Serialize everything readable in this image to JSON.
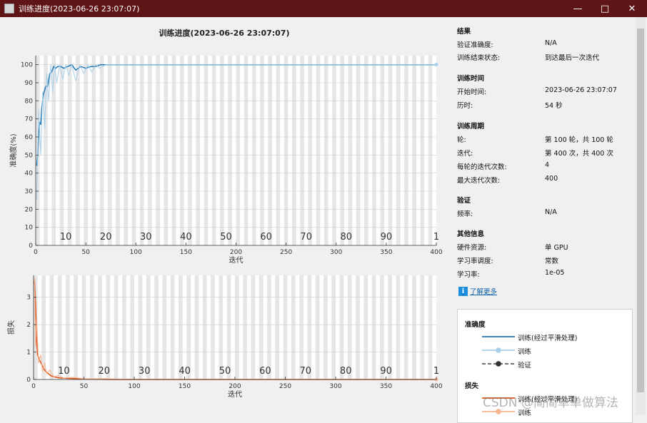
{
  "window": {
    "title": "训练进度(2023-06-26 23:07:07)",
    "minimize_icon": "minimize-icon",
    "maximize_icon": "maximize-icon",
    "close_icon": "close-icon"
  },
  "plot_title": "训练进度(2023-06-26 23:07:07)",
  "chart_data": [
    {
      "type": "line",
      "xlabel": "迭代",
      "ylabel": "准确度(%)",
      "xlim": [
        0,
        400
      ],
      "ylim": [
        0,
        105
      ],
      "xticks": [
        0,
        50,
        100,
        150,
        200,
        250,
        300,
        350,
        400
      ],
      "yticks": [
        0,
        10,
        20,
        30,
        40,
        50,
        60,
        70,
        80,
        90,
        100
      ],
      "epoch_labels": [
        "10",
        "20",
        "30",
        "40",
        "50",
        "60",
        "70",
        "80",
        "90",
        "1"
      ],
      "epoch_label_iterations": [
        40,
        80,
        120,
        160,
        200,
        240,
        280,
        320,
        360,
        400
      ],
      "series": [
        {
          "name": "训练(经过平滑处理)",
          "color": "#1f77b4",
          "x": [
            1,
            2,
            3,
            4,
            5,
            6,
            7,
            8,
            10,
            12,
            14,
            16,
            18,
            20,
            22,
            25,
            28,
            32,
            36,
            40,
            45,
            50,
            55,
            60,
            65,
            70,
            100,
            200,
            300,
            400
          ],
          "y": [
            44,
            50,
            62,
            68,
            67,
            76,
            80,
            84,
            88,
            88,
            95,
            96,
            99,
            98,
            99,
            99,
            98,
            99,
            100,
            97,
            99,
            98,
            99,
            99,
            100,
            100,
            100,
            100,
            100,
            100
          ]
        },
        {
          "name": "训练",
          "color": "#a9cfe9",
          "x": [
            1,
            3,
            5,
            7,
            9,
            11,
            13,
            15,
            17,
            19,
            21,
            24,
            27,
            30,
            33,
            36,
            40,
            44,
            48,
            52,
            56,
            60,
            64,
            70,
            100,
            400
          ],
          "y": [
            25,
            75,
            50,
            85,
            65,
            95,
            80,
            100,
            85,
            100,
            90,
            100,
            92,
            100,
            94,
            100,
            91,
            100,
            95,
            100,
            96,
            100,
            98,
            100,
            100,
            100
          ]
        }
      ]
    },
    {
      "type": "line",
      "xlabel": "迭代",
      "ylabel": "损失",
      "xlim": [
        0,
        400
      ],
      "ylim": [
        0,
        3.8
      ],
      "xticks": [
        0,
        50,
        100,
        150,
        200,
        250,
        300,
        350,
        400
      ],
      "yticks": [
        0,
        1,
        2,
        3
      ],
      "epoch_labels": [
        "10",
        "20",
        "30",
        "40",
        "50",
        "60",
        "70",
        "80",
        "90",
        "1"
      ],
      "epoch_label_iterations": [
        40,
        80,
        120,
        160,
        200,
        240,
        280,
        320,
        360,
        400
      ],
      "series": [
        {
          "name": "训练(经过平滑处理)",
          "color": "#d95319",
          "x": [
            1,
            2,
            3,
            4,
            6,
            8,
            10,
            12,
            15,
            18,
            22,
            26,
            30,
            40,
            50,
            60,
            80,
            100,
            200,
            300,
            400
          ],
          "y": [
            3.6,
            2.8,
            1.5,
            0.9,
            0.7,
            0.55,
            0.4,
            0.3,
            0.2,
            0.12,
            0.08,
            0.06,
            0.05,
            0.03,
            0.02,
            0.01,
            0.0,
            0.0,
            0.0,
            0.0,
            0.0
          ]
        },
        {
          "name": "训练",
          "color": "#f4b48f",
          "x": [
            1,
            2,
            3,
            5,
            7,
            9,
            11,
            13,
            16,
            20,
            25,
            30,
            40,
            50,
            70,
            100,
            400
          ],
          "y": [
            3.7,
            1.2,
            2.2,
            0.6,
            0.9,
            0.3,
            0.6,
            0.2,
            0.35,
            0.1,
            0.15,
            0.05,
            0.08,
            0.02,
            0.03,
            0.0,
            0.0
          ]
        }
      ]
    }
  ],
  "side": {
    "results": {
      "title": "结果",
      "rows": [
        {
          "label": "验证准确度:",
          "value": "N/A"
        },
        {
          "label": "训练结束状态:",
          "value": "到达最后一次迭代"
        }
      ]
    },
    "time": {
      "title": "训练时间",
      "rows": [
        {
          "label": "开始时间:",
          "value": "2023-06-26 23:07:07"
        },
        {
          "label": "历时:",
          "value": "54 秒"
        }
      ]
    },
    "cycle": {
      "title": "训练周期",
      "rows": [
        {
          "label": "轮:",
          "value": "第 100 轮，共 100 轮"
        },
        {
          "label": "迭代:",
          "value": "第 400 次，共 400 次"
        },
        {
          "label": "每轮的迭代次数:",
          "value": "4"
        },
        {
          "label": "最大迭代次数:",
          "value": "400"
        }
      ]
    },
    "validation": {
      "title": "验证",
      "rows": [
        {
          "label": "频率:",
          "value": "N/A"
        }
      ]
    },
    "other": {
      "title": "其他信息",
      "rows": [
        {
          "label": "硬件资源:",
          "value": "单 GPU"
        },
        {
          "label": "学习率调度:",
          "value": "常数"
        },
        {
          "label": "学习率:",
          "value": "1e-05"
        }
      ]
    },
    "learn_more": "了解更多",
    "learn_more_icon": "info-icon"
  },
  "legend": {
    "accuracy_title": "准确度",
    "accuracy_items": [
      {
        "label": "训练(经过平滑处理)",
        "color": "#1f77b4",
        "style": "solid"
      },
      {
        "label": "训练",
        "color": "#a9cfe9",
        "style": "solid-marker"
      },
      {
        "label": "验证",
        "color": "#444444",
        "style": "dashed-marker"
      }
    ],
    "loss_title": "损失",
    "loss_items": [
      {
        "label": "训练(经过平滑处理)",
        "color": "#d95319",
        "style": "solid"
      },
      {
        "label": "训练",
        "color": "#f4b48f",
        "style": "solid-marker"
      }
    ]
  },
  "watermark": "CSDN @简简单单做算法"
}
